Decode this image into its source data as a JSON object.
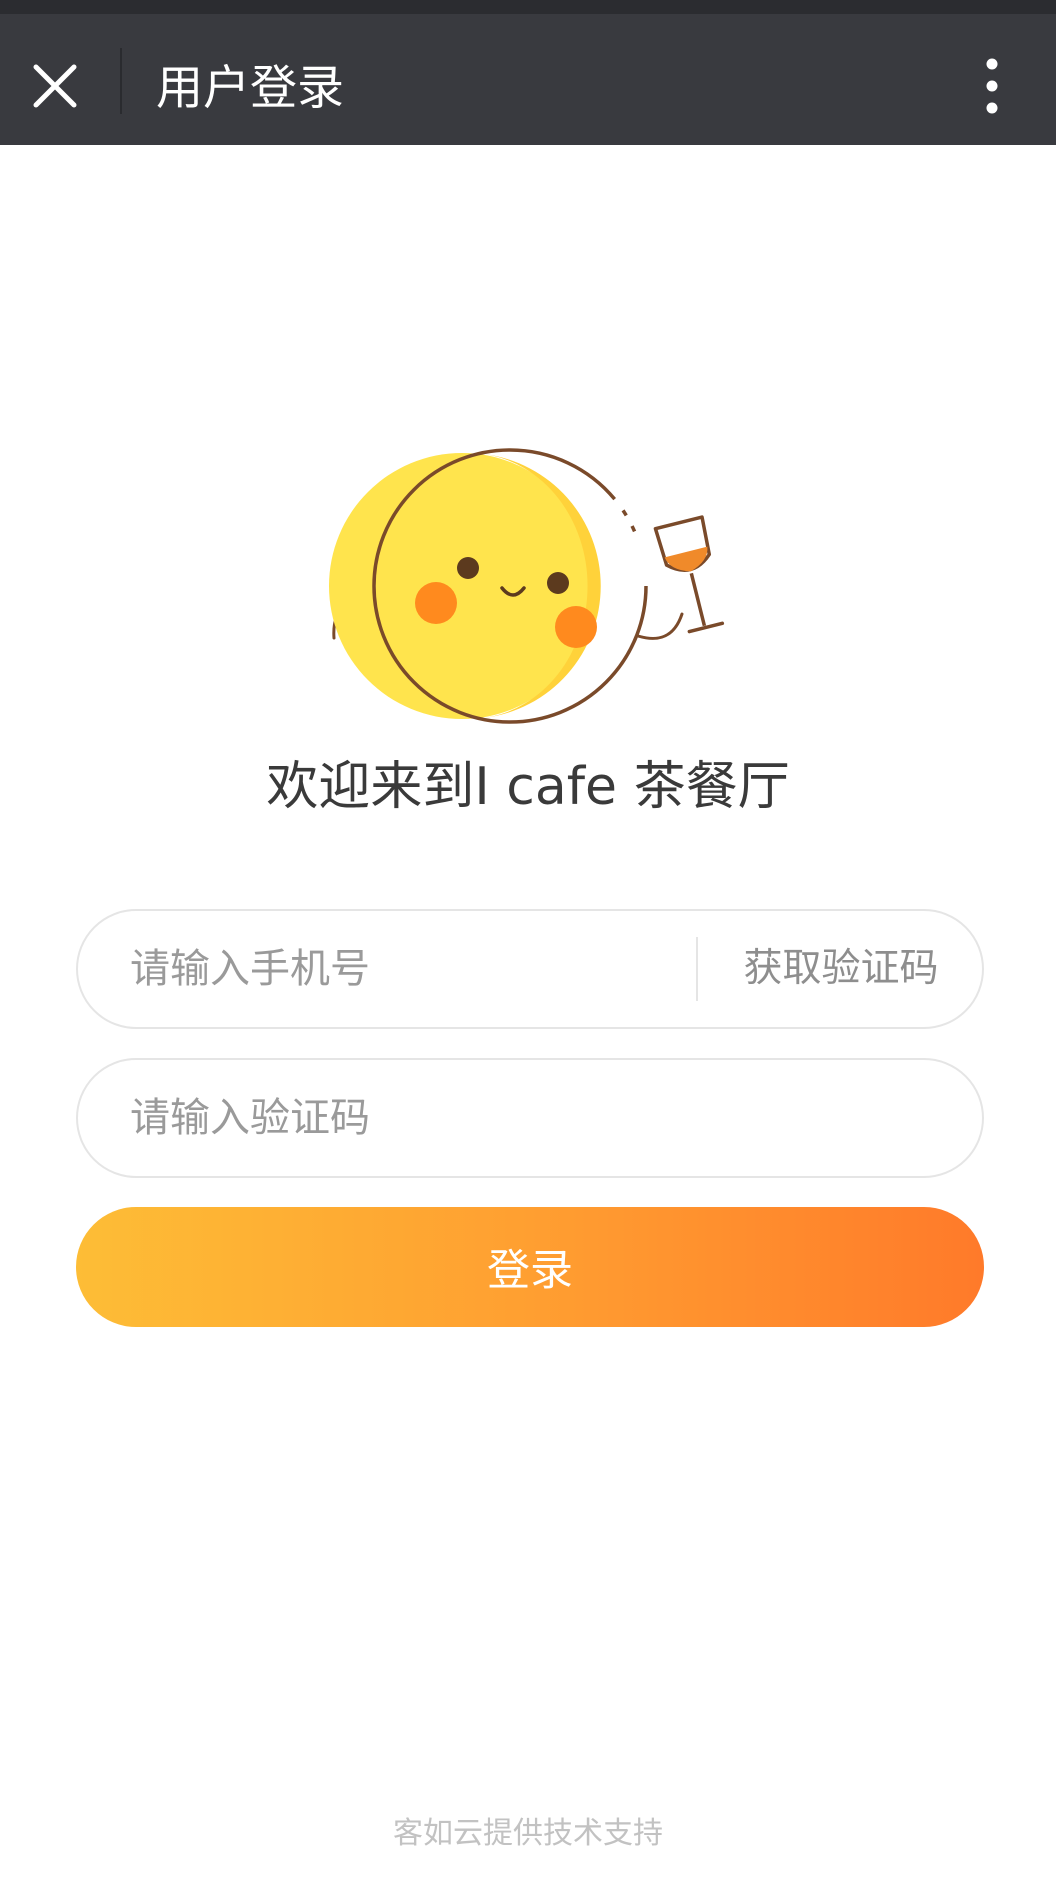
{
  "navbar": {
    "title": "用户登录",
    "close_icon": "close-icon",
    "more_icon": "more-vertical-icon"
  },
  "hero": {
    "mascot_icon": "smiling-mascot-with-wine-glass",
    "welcome_text": "欢迎来到I cafe 茶餐厅"
  },
  "form": {
    "phone_placeholder": "请输入手机号",
    "get_code_label": "获取验证码",
    "code_placeholder": "请输入验证码",
    "login_label": "登录"
  },
  "footer": {
    "text": "客如云提供技术支持"
  },
  "colors": {
    "navbar_bg": "#393a3f",
    "button_gradient_start": "#fdbd36",
    "button_gradient_end": "#ff7a2a",
    "mascot_face": "#ffe44d",
    "mascot_cheek": "#ff8a1e",
    "mascot_outline": "#7a4a2a"
  }
}
